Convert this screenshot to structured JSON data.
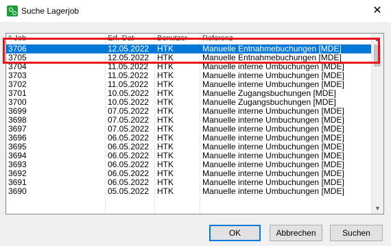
{
  "window": {
    "title": "Suche Lagerjob",
    "close_glyph": "✕"
  },
  "list": {
    "columns": [
      "Job",
      "Erf.-Dat",
      "Benutzer",
      "Referenz"
    ],
    "selected_index": 0,
    "rows": [
      [
        "3706",
        "12.05.2022",
        "HTK",
        "Manuelle Entnahmebuchungen [MDE]"
      ],
      [
        "3705",
        "12.05.2022",
        "HTK",
        "Manuelle Entnahmebuchungen [MDE]"
      ],
      [
        "3704",
        "11.05.2022",
        "HTK",
        "Manuelle interne Umbuchungen [MDE]"
      ],
      [
        "3703",
        "11.05.2022",
        "HTK",
        "Manuelle interne Umbuchungen [MDE]"
      ],
      [
        "3702",
        "11.05.2022",
        "HTK",
        "Manuelle interne Umbuchungen [MDE]"
      ],
      [
        "3701",
        "10.05.2022",
        "HTK",
        "Manuelle Zugangsbuchungen [MDE]"
      ],
      [
        "3700",
        "10.05.2022",
        "HTK",
        "Manuelle Zugangsbuchungen [MDE]"
      ],
      [
        "3699",
        "07.05.2022",
        "HTK",
        "Manuelle interne Umbuchungen [MDE]"
      ],
      [
        "3698",
        "07.05.2022",
        "HTK",
        "Manuelle interne Umbuchungen [MDE]"
      ],
      [
        "3697",
        "07.05.2022",
        "HTK",
        "Manuelle interne Umbuchungen [MDE]"
      ],
      [
        "3696",
        "06.05.2022",
        "HTK",
        "Manuelle interne Umbuchungen [MDE]"
      ],
      [
        "3695",
        "06.05.2022",
        "HTK",
        "Manuelle interne Umbuchungen [MDE]"
      ],
      [
        "3694",
        "06.05.2022",
        "HTK",
        "Manuelle interne Umbuchungen [MDE]"
      ],
      [
        "3693",
        "06.05.2022",
        "HTK",
        "Manuelle interne Umbuchungen [MDE]"
      ],
      [
        "3692",
        "06.05.2022",
        "HTK",
        "Manuelle interne Umbuchungen [MDE]"
      ],
      [
        "3691",
        "06.05.2022",
        "HTK",
        "Manuelle interne Umbuchungen [MDE]"
      ],
      [
        "3690",
        "05.05.2022",
        "HTK",
        "Manuelle interne Umbuchungen [MDE]"
      ]
    ]
  },
  "buttons": {
    "ok": "OK",
    "cancel": "Abbrechen",
    "search": "Suchen"
  },
  "colors": {
    "selection": "#0078d7",
    "annotation": "#e8121e"
  }
}
